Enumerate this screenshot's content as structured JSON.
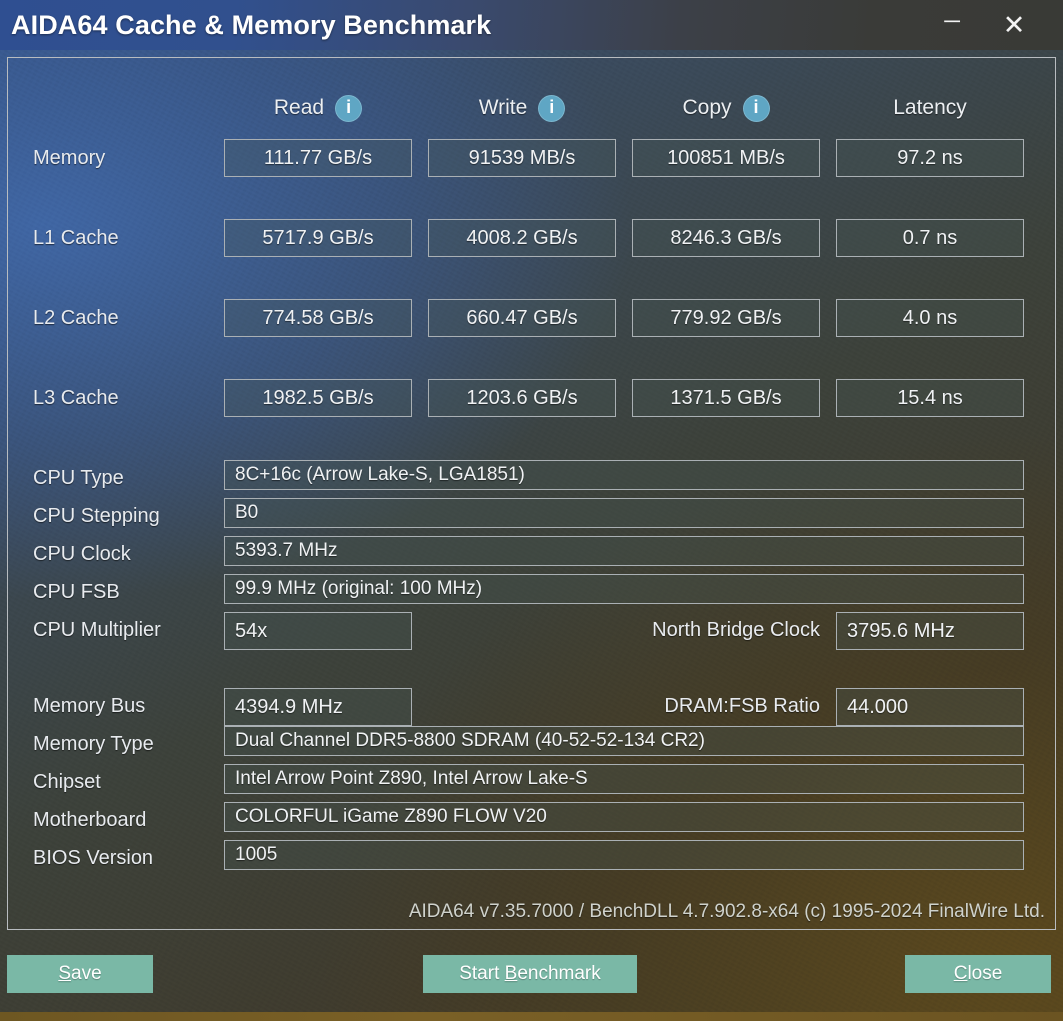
{
  "window": {
    "title": "AIDA64 Cache & Memory Benchmark",
    "minimize_label": "─",
    "close_label": "✕"
  },
  "benchmark": {
    "columns": [
      {
        "label": "Read",
        "has_info": true,
        "icon": "info-icon"
      },
      {
        "label": "Write",
        "has_info": true,
        "icon": "info-icon"
      },
      {
        "label": "Copy",
        "has_info": true,
        "icon": "info-icon"
      },
      {
        "label": "Latency",
        "has_info": false,
        "icon": ""
      }
    ],
    "info_glyph": "i",
    "rows": [
      {
        "label": "Memory",
        "read": "111.77 GB/s",
        "write": "91539 MB/s",
        "copy": "100851 MB/s",
        "latency": "97.2 ns"
      },
      {
        "label": "L1 Cache",
        "read": "5717.9 GB/s",
        "write": "4008.2 GB/s",
        "copy": "8246.3 GB/s",
        "latency": "0.7 ns"
      },
      {
        "label": "L2 Cache",
        "read": "774.58 GB/s",
        "write": "660.47 GB/s",
        "copy": "779.92 GB/s",
        "latency": "4.0 ns"
      },
      {
        "label": "L3 Cache",
        "read": "1982.5 GB/s",
        "write": "1203.6 GB/s",
        "copy": "1371.5 GB/s",
        "latency": "15.4 ns"
      }
    ]
  },
  "cpu_info": {
    "type_label": "CPU Type",
    "type_value": "8C+16c   (Arrow Lake-S, LGA1851)",
    "stepping_label": "CPU Stepping",
    "stepping_value": "B0",
    "clock_label": "CPU Clock",
    "clock_value": "5393.7 MHz",
    "fsb_label": "CPU FSB",
    "fsb_value": "99.9 MHz  (original: 100 MHz)",
    "multiplier_label": "CPU Multiplier",
    "multiplier_value": "54x",
    "north_bridge_label": "North Bridge Clock",
    "north_bridge_value": "3795.6 MHz"
  },
  "memory_info": {
    "bus_label": "Memory Bus",
    "bus_value": "4394.9 MHz",
    "dram_fsb_label": "DRAM:FSB Ratio",
    "dram_fsb_value": "44.000",
    "type_label": "Memory Type",
    "type_value": "Dual Channel DDR5-8800 SDRAM  (40-52-52-134 CR2)",
    "chipset_label": "Chipset",
    "chipset_value": "Intel Arrow Point Z890, Intel Arrow Lake-S",
    "motherboard_label": "Motherboard",
    "motherboard_value": "COLORFUL iGame Z890 FLOW V20",
    "bios_label": "BIOS Version",
    "bios_value": "1005"
  },
  "footer": {
    "version_text": "AIDA64 v7.35.7000 / BenchDLL 4.7.902.8-x64  (c) 1995-2024 FinalWire Ltd."
  },
  "buttons": {
    "save": {
      "prefix": "",
      "accel": "S",
      "suffix": "ave"
    },
    "start_benchmark": {
      "prefix": "Start ",
      "accel": "B",
      "suffix": "enchmark"
    },
    "close": {
      "prefix": "",
      "accel": "C",
      "suffix": "lose"
    }
  },
  "colors": {
    "accent_button": "#7ab8a6",
    "info_icon": "#5fa6c4",
    "panel_border": "#b8bcc0",
    "title_blue": "#2f4f91"
  }
}
